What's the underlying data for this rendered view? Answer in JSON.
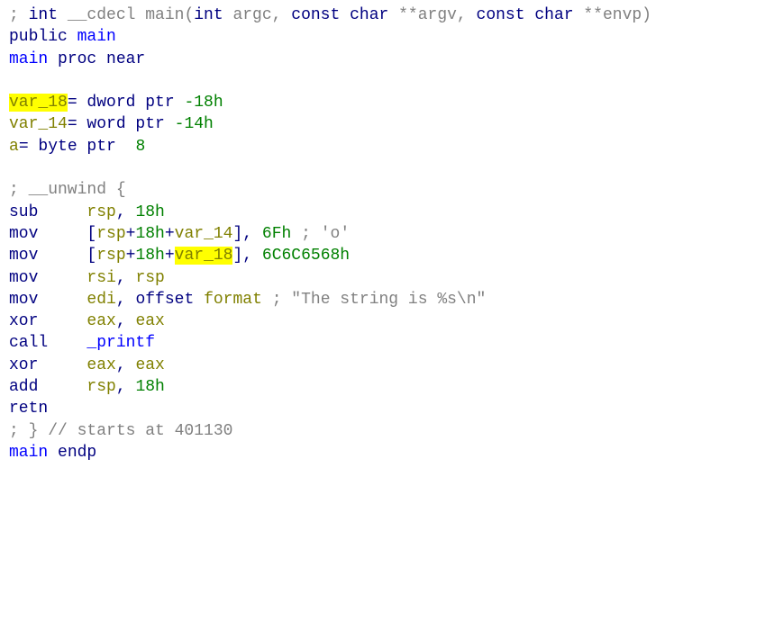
{
  "l1": {
    "c1": "; ",
    "c2": "int",
    "c3": " __cdecl ",
    "c4": "main(",
    "c5": "int",
    "c6": " argc, ",
    "c7": "const",
    "c8": " char",
    "c9": " **argv, ",
    "c10": "const",
    "c11": " char",
    "c12": " **envp)"
  },
  "l2": {
    "c1": "public ",
    "c2": "main"
  },
  "l3": {
    "c1": "main ",
    "c2": "proc ",
    "c3": "near"
  },
  "l5": {
    "c1": "var_18",
    "c2": "= dword ptr ",
    "c3": "-18h"
  },
  "l6": {
    "c1": "var_14",
    "c2": "= word ptr ",
    "c3": "-14h"
  },
  "l7": {
    "c1": "a",
    "c2": "= byte ptr  ",
    "c3": "8"
  },
  "l9": "; __unwind {",
  "l10": {
    "c1": "sub     ",
    "c2": "rsp",
    "c3": ", ",
    "c4": "18h"
  },
  "l11": {
    "c1": "mov     ",
    "c2": "[",
    "c3": "rsp",
    "c4": "+",
    "c5": "18h",
    "c6": "+",
    "c7": "var_14",
    "c8": "], ",
    "c9": "6Fh ",
    "c10": "; 'o'"
  },
  "l12": {
    "c1": "mov     ",
    "c2": "[",
    "c3": "rsp",
    "c4": "+",
    "c5": "18h",
    "c6": "+",
    "c7": "var_18",
    "c8": "], ",
    "c9": "6C6C6568h"
  },
  "l13": {
    "c1": "mov     ",
    "c2": "rsi",
    "c3": ", ",
    "c4": "rsp"
  },
  "l14": {
    "c1": "mov     ",
    "c2": "edi",
    "c3": ", ",
    "c4": "offset ",
    "c5": "format ",
    "c6": "; \"The string is %s\\n\""
  },
  "l15": {
    "c1": "xor     ",
    "c2": "eax",
    "c3": ", ",
    "c4": "eax"
  },
  "l16": {
    "c1": "call    ",
    "c2": "_printf"
  },
  "l17": {
    "c1": "xor     ",
    "c2": "eax",
    "c3": ", ",
    "c4": "eax"
  },
  "l18": {
    "c1": "add     ",
    "c2": "rsp",
    "c3": ", ",
    "c4": "18h"
  },
  "l19": "retn",
  "l20": "; } // starts at 401130",
  "l21": {
    "c1": "main ",
    "c2": "endp"
  }
}
